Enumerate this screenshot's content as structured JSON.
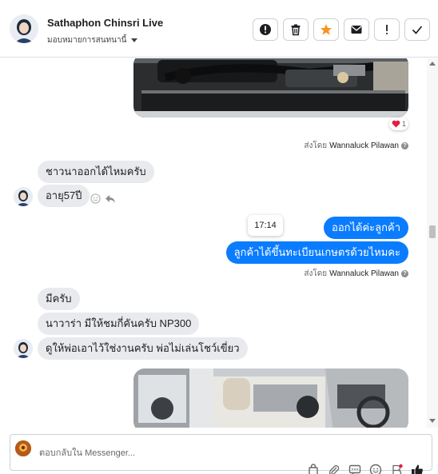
{
  "header": {
    "name": "Sathaphon Chinsri Live",
    "assign_label": "มอบหมายการสนทนานี้",
    "actions": [
      {
        "icon": "alert-circle-icon",
        "label": "Mark as spam"
      },
      {
        "icon": "trash-icon",
        "label": "Delete"
      },
      {
        "icon": "star-icon",
        "label": "Star"
      },
      {
        "icon": "envelope-icon",
        "label": "Mark as unread"
      },
      {
        "icon": "exclamation-icon",
        "label": "Flag"
      },
      {
        "icon": "check-icon",
        "label": "Done"
      }
    ]
  },
  "messages": {
    "reaction_count": "1",
    "sent_by_prefix": "ส่งโดย",
    "sent_by_name": "Wannaluck Pilawan",
    "in_1": "ชาวนาออกได้ไหมครับ",
    "in_2": "อายุ57ปี",
    "tooltip_time": "17:14",
    "out_1": "ออกได้ค่ะลูกค้า",
    "out_2": "ลูกค้าได้ขึ้นทะเบียนเกษตรด้วยไหมคะ",
    "in_3": "มีครับ",
    "in_4": "นาวาร่า มีให้ชมกี่คันครับ NP300",
    "in_5": "ดูให้พ่อเอาไว้ใช่งานครับ พ่อไม่เล่นโชว์เขี่ยว"
  },
  "composer": {
    "placeholder": "ตอบกลับใน Messenger..."
  },
  "colors": {
    "accent": "#0a7cff",
    "star": "#f7931e",
    "incoming_bubble": "#e9eaed"
  }
}
